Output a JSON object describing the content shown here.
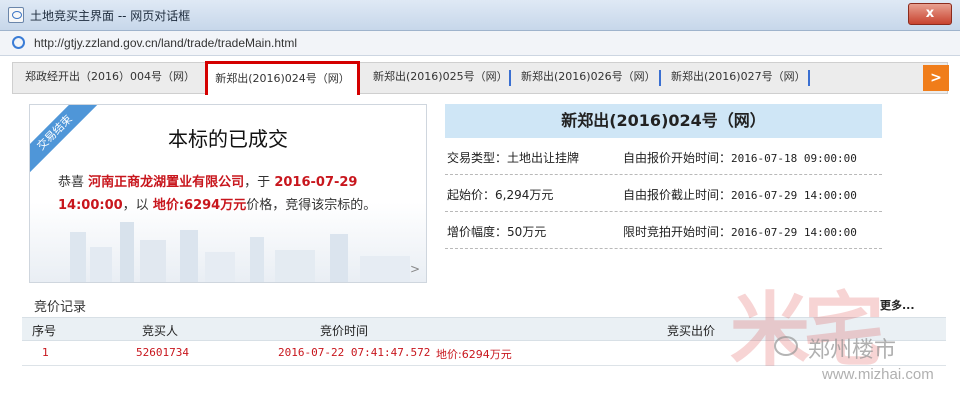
{
  "window": {
    "title": "土地竞买主界面 -- 网页对话框",
    "close_label": "x",
    "url": "http://gtjy.zzland.gov.cn/land/trade/tradeMain.html"
  },
  "tabs": [
    {
      "label": "郑政经开出（2016）004号（网）"
    },
    {
      "label": "新郑出(2016)024号（网）",
      "active": true
    },
    {
      "label": "新郑出(2016)025号（网）"
    },
    {
      "label": "新郑出(2016)026号（网）"
    },
    {
      "label": "新郑出(2016)027号（网）"
    }
  ],
  "tabs_next": ">",
  "result": {
    "ribbon": "交易结束",
    "title": "本标的已成交",
    "prefix": "恭喜",
    "company": "河南正商龙湖置业有限公司",
    "mid1": "，于",
    "time": "2016-07-29 14:00:00",
    "mid2": "，以",
    "price": "地价:6294万元",
    "suffix": "价格，竞得该宗标的。",
    "arrow": ">"
  },
  "info": {
    "header": "新郑出(2016)024号（网）",
    "rows": [
      {
        "k1": "交易类型：土地出让挂牌",
        "k2": "自由报价开始时间：",
        "v2": "2016-07-18 09:00:00"
      },
      {
        "k1": "起始价：6,294万元",
        "k2": "自由报价截止时间：",
        "v2": "2016-07-29 14:00:00"
      },
      {
        "k1": "增价幅度：50万元",
        "k2": "限时竞拍开始时间：",
        "v2": "2016-07-29 14:00:00"
      }
    ]
  },
  "bids": {
    "title": "竞价记录",
    "more": "更多...",
    "columns": [
      "序号",
      "竞买人",
      "竞价时间",
      "竞买出价"
    ],
    "rows": [
      {
        "no": "1",
        "bidder": "52601734",
        "time": "2016-07-22 07:41:47.572",
        "price": "地价:6294万元"
      }
    ]
  },
  "watermark": {
    "glyph": "米宅",
    "text": "郑州楼市",
    "url": "www.mizhai.com"
  },
  "colors": {
    "accent_red": "#d40000",
    "header_blue": "#cfe6f6",
    "next_orange": "#f07d1a"
  }
}
